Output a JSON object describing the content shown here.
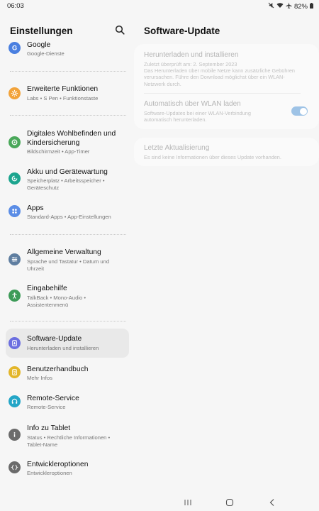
{
  "status": {
    "time": "06:03",
    "battery": "82%"
  },
  "left": {
    "title": "Einstellungen"
  },
  "right": {
    "title": "Software-Update"
  },
  "sidebar": {
    "items": [
      {
        "title": "Google",
        "subtitle": "Google-Dienste",
        "icon": "google-icon",
        "color": "#4a7fe0"
      },
      {
        "title": "Erweiterte Funktionen",
        "subtitle": "Labs  •  S Pen  •  Funktionstaste",
        "icon": "advanced-features-icon",
        "color": "#f2a33a"
      },
      {
        "title": "Digitales Wohlbefinden und Kindersicherung",
        "subtitle": "Bildschirmzeit  •  App-Timer",
        "icon": "wellbeing-icon",
        "color": "#4aa85a"
      },
      {
        "title": "Akku und Gerätewartung",
        "subtitle": "Speicherplatz  •  Arbeitsspeicher  •  Geräteschutz",
        "icon": "device-care-icon",
        "color": "#1ca58f"
      },
      {
        "title": "Apps",
        "subtitle": "Standard-Apps  •  App-Einstellungen",
        "icon": "apps-icon",
        "color": "#5b8de6"
      },
      {
        "title": "Allgemeine Verwaltung",
        "subtitle": "Sprache und Tastatur  •  Datum und Uhrzeit",
        "icon": "general-management-icon",
        "color": "#5f7ea0"
      },
      {
        "title": "Eingabehilfe",
        "subtitle": "TalkBack  •  Mono-Audio  •  Assistentenmenü",
        "icon": "accessibility-icon",
        "color": "#3d9b58"
      },
      {
        "title": "Software-Update",
        "subtitle": "Herunterladen und installieren",
        "icon": "software-update-icon",
        "color": "#6c6fe0"
      },
      {
        "title": "Benutzerhandbuch",
        "subtitle": "Mehr Infos",
        "icon": "user-manual-icon",
        "color": "#e3b62a"
      },
      {
        "title": "Remote-Service",
        "subtitle": "Remote-Service",
        "icon": "remote-service-icon",
        "color": "#24a6c7"
      },
      {
        "title": "Info zu Tablet",
        "subtitle": "Status  •  Rechtliche Informationen  •  Tablet-Name",
        "icon": "info-icon",
        "color": "#6b6b6b"
      },
      {
        "title": "Entwickleroptionen",
        "subtitle": "Entwickleroptionen",
        "icon": "developer-options-icon",
        "color": "#6b6b6b"
      }
    ]
  },
  "update": {
    "download": {
      "title": "Herunterladen und installieren",
      "line1": "Zuletzt überprüft am: 2. September 2023",
      "line2": "Das Herunterladen über mobile Netze kann zusätzliche Gebühren verursachen. Führe den Download möglichst über ein WLAN-Netzwerk durch."
    },
    "wifi": {
      "title": "Automatisch über WLAN laden",
      "desc": "Software-Updates bei einer WLAN-Verbindung automatisch herunterladen.",
      "enabled": true
    },
    "last": {
      "title": "Letzte Aktualisierung",
      "desc": "Es sind keine Informationen über dieses Update vorhanden."
    }
  }
}
